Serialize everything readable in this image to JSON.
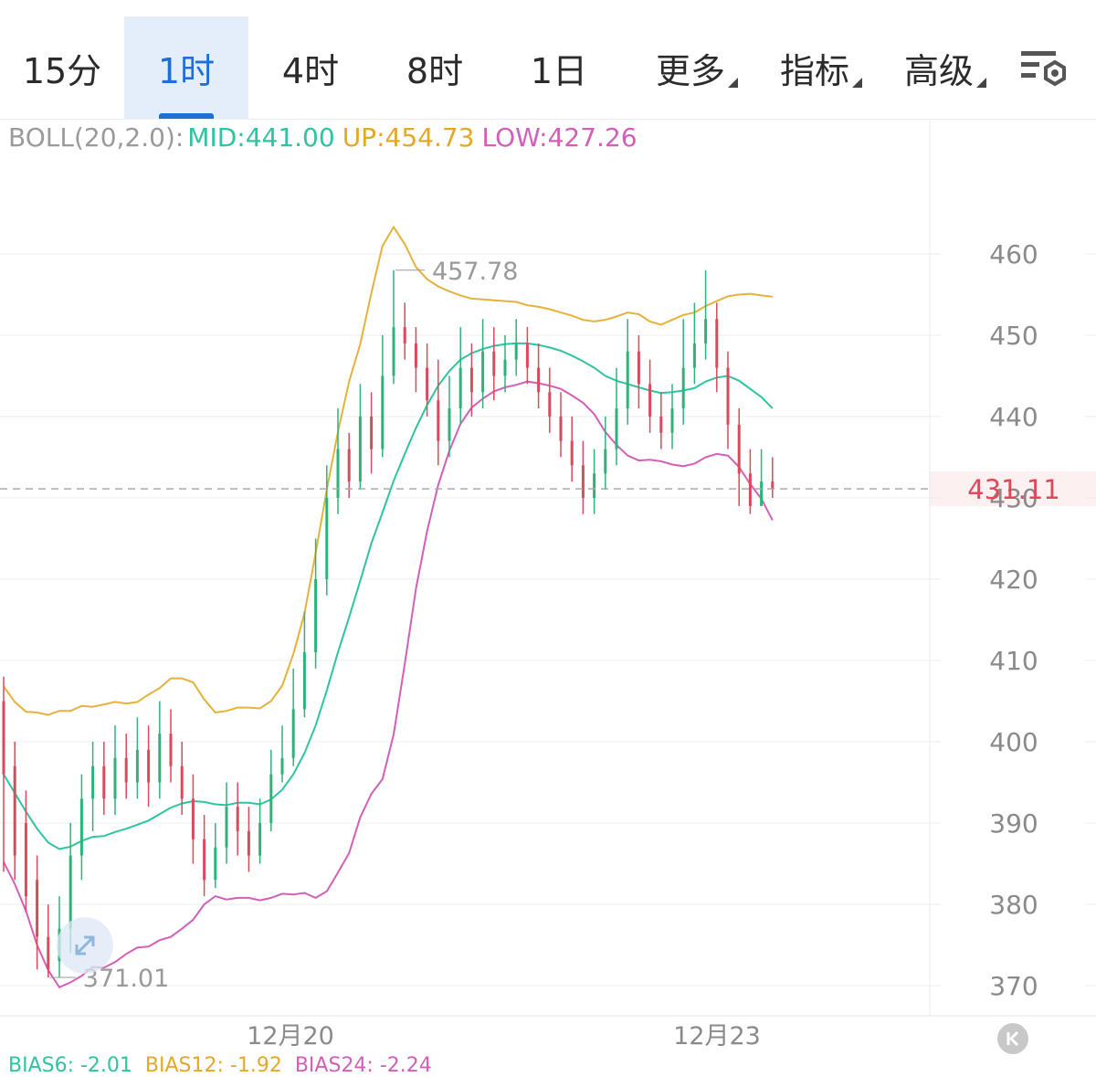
{
  "tabs": [
    {
      "label": "15分",
      "active": false,
      "dropdown": false
    },
    {
      "label": "1时",
      "active": true,
      "dropdown": false
    },
    {
      "label": "4时",
      "active": false,
      "dropdown": false
    },
    {
      "label": "8时",
      "active": false,
      "dropdown": false
    },
    {
      "label": "1日",
      "active": false,
      "dropdown": false
    },
    {
      "label": "更多",
      "active": false,
      "dropdown": true
    },
    {
      "label": "指标",
      "active": false,
      "dropdown": true
    },
    {
      "label": "高级",
      "active": false,
      "dropdown": true
    }
  ],
  "settings_icon": "chart-settings-icon",
  "indicator": {
    "label": "BOLL(20,2.0):",
    "mid": "MID:441.00",
    "up": "UP:454.73",
    "low": "LOW:427.26"
  },
  "bias": {
    "b1": "BIAS6: -2.01",
    "b2": "BIAS12: -1.92",
    "b3": "BIAS24: -2.24"
  },
  "colors": {
    "up_candle": "#2fb27a",
    "down_candle": "#d94a5a",
    "mid": "#2ec4a1",
    "up_band": "#e5b23a",
    "low_band": "#d35fb8",
    "last_price": "#e0485a"
  },
  "chart_data": {
    "type": "candlestick",
    "y_ticks": [
      460,
      450,
      440,
      430,
      420,
      410,
      400,
      390,
      380,
      370
    ],
    "ylim": [
      367,
      471
    ],
    "x_tick_labels": [
      "12月20",
      "12月23"
    ],
    "high_annotation": "457.78",
    "low_annotation": "371.01",
    "last_price": "431.11",
    "last_price_value": 431.11,
    "candles": [
      [
        405,
        396,
        408,
        384
      ],
      [
        397,
        386,
        400,
        383
      ],
      [
        390,
        381,
        394,
        379
      ],
      [
        383,
        376,
        386,
        372
      ],
      [
        376,
        372,
        380,
        371.01
      ],
      [
        373,
        377,
        381,
        371
      ],
      [
        377,
        386,
        390,
        374
      ],
      [
        386,
        393,
        396,
        383
      ],
      [
        393,
        397,
        400,
        389
      ],
      [
        397,
        393,
        400,
        391
      ],
      [
        393,
        398,
        402,
        391
      ],
      [
        398,
        395,
        401,
        393
      ],
      [
        395,
        399,
        403,
        393
      ],
      [
        399,
        395,
        402,
        392
      ],
      [
        395,
        401,
        405,
        393
      ],
      [
        401,
        397,
        404,
        395
      ],
      [
        397,
        393,
        400,
        391
      ],
      [
        393,
        388,
        396,
        385
      ],
      [
        388,
        383,
        391,
        381
      ],
      [
        383,
        387,
        390,
        382
      ],
      [
        387,
        392,
        395,
        385
      ],
      [
        392,
        389,
        395,
        386
      ],
      [
        389,
        386,
        392,
        384
      ],
      [
        386,
        390,
        393,
        385
      ],
      [
        390,
        396,
        399,
        389
      ],
      [
        396,
        398,
        402,
        395
      ],
      [
        398,
        404,
        409,
        397
      ],
      [
        404,
        411,
        416,
        403
      ],
      [
        411,
        420,
        425,
        409
      ],
      [
        420,
        430,
        434,
        418
      ],
      [
        430,
        436,
        441,
        428
      ],
      [
        436,
        432,
        438,
        430
      ],
      [
        432,
        440,
        444,
        431
      ],
      [
        440,
        436,
        443,
        433
      ],
      [
        436,
        445,
        450,
        435
      ],
      [
        445,
        451,
        458,
        444
      ],
      [
        451,
        449,
        454,
        447
      ],
      [
        449,
        446,
        451,
        443
      ],
      [
        446,
        442,
        449,
        440
      ],
      [
        442,
        437,
        447,
        434
      ],
      [
        437,
        441,
        445,
        435
      ],
      [
        441,
        446,
        451,
        439
      ],
      [
        446,
        443,
        449,
        440
      ],
      [
        443,
        448,
        452,
        441
      ],
      [
        448,
        445,
        451,
        442
      ],
      [
        445,
        447,
        450,
        443
      ],
      [
        447,
        449,
        452,
        445
      ],
      [
        449,
        446,
        451,
        444
      ],
      [
        446,
        443,
        449,
        441
      ],
      [
        443,
        440,
        446,
        438
      ],
      [
        440,
        437,
        443,
        435
      ],
      [
        437,
        434,
        440,
        432
      ],
      [
        434,
        430,
        437,
        428
      ],
      [
        430,
        433,
        436,
        428
      ],
      [
        433,
        436,
        440,
        431
      ],
      [
        436,
        441,
        446,
        434
      ],
      [
        441,
        448,
        452,
        439
      ],
      [
        448,
        444,
        450,
        441
      ],
      [
        444,
        440,
        447,
        438
      ],
      [
        440,
        438,
        443,
        436
      ],
      [
        438,
        441,
        444,
        436
      ],
      [
        441,
        446,
        452,
        439
      ],
      [
        446,
        449,
        454,
        444
      ],
      [
        449,
        452,
        458,
        447
      ],
      [
        452,
        446,
        454,
        443
      ],
      [
        446,
        439,
        448,
        436
      ],
      [
        439,
        433,
        441,
        429
      ],
      [
        433,
        429,
        436,
        428
      ],
      [
        429,
        432,
        436,
        429
      ],
      [
        432,
        431.11,
        435,
        430
      ]
    ],
    "mid_series": [
      396.0,
      393.7,
      391.4,
      389.3,
      387.6,
      386.8,
      387.1,
      387.8,
      388.3,
      388.4,
      388.9,
      389.3,
      389.8,
      390.3,
      391.1,
      391.9,
      392.4,
      392.7,
      392.6,
      392.3,
      392.2,
      392.5,
      392.5,
      392.3,
      392.9,
      394.1,
      396.0,
      398.6,
      402.0,
      406.3,
      411.0,
      415.3,
      419.8,
      424.4,
      428.2,
      432.1,
      435.4,
      438.6,
      441.4,
      443.8,
      445.6,
      447.0,
      447.8,
      448.3,
      448.7,
      448.9,
      449.0,
      449.0,
      448.8,
      448.5,
      448.1,
      447.5,
      446.8,
      446.0,
      445.0,
      444.4,
      444.0,
      443.6,
      443.2,
      442.9,
      443.0,
      443.2,
      443.5,
      444.3,
      444.8,
      445.0,
      444.4,
      443.4,
      442.4,
      441.0
    ],
    "up_series": [
      406.8,
      404.9,
      403.7,
      403.6,
      403.3,
      403.8,
      403.8,
      404.4,
      404.3,
      404.6,
      404.9,
      404.7,
      404.9,
      405.8,
      406.6,
      407.8,
      407.8,
      407.3,
      405.2,
      403.6,
      403.8,
      404.2,
      404.2,
      404.1,
      405.0,
      406.9,
      410.8,
      415.8,
      423.2,
      431.0,
      438.1,
      444.3,
      448.9,
      455.2,
      461.0,
      463.3,
      461.2,
      458.4,
      456.9,
      456.0,
      455.4,
      454.9,
      454.5,
      454.4,
      454.3,
      454.2,
      454.1,
      453.7,
      453.5,
      453.2,
      452.8,
      452.4,
      451.9,
      451.7,
      451.9,
      452.3,
      452.8,
      452.6,
      451.7,
      451.3,
      451.9,
      452.5,
      452.8,
      453.6,
      454.2,
      454.8,
      455.0,
      455.1,
      454.9,
      454.73
    ],
    "low_series": [
      385.2,
      382.5,
      379.2,
      375.0,
      371.9,
      369.8,
      370.4,
      371.2,
      372.3,
      372.2,
      372.9,
      373.9,
      374.7,
      374.8,
      375.6,
      376.0,
      377.0,
      378.1,
      380.0,
      381.0,
      380.6,
      380.8,
      380.8,
      380.5,
      380.8,
      381.3,
      381.2,
      381.4,
      380.8,
      381.6,
      383.9,
      386.3,
      390.7,
      393.6,
      395.4,
      400.9,
      409.6,
      418.8,
      425.9,
      431.6,
      435.8,
      439.1,
      441.1,
      442.2,
      443.1,
      443.6,
      443.9,
      444.3,
      444.1,
      443.8,
      443.4,
      442.6,
      441.7,
      440.3,
      438.1,
      436.5,
      435.2,
      434.6,
      434.7,
      434.5,
      434.1,
      433.9,
      434.2,
      435.0,
      435.4,
      435.2,
      433.8,
      431.7,
      429.9,
      427.26
    ]
  }
}
